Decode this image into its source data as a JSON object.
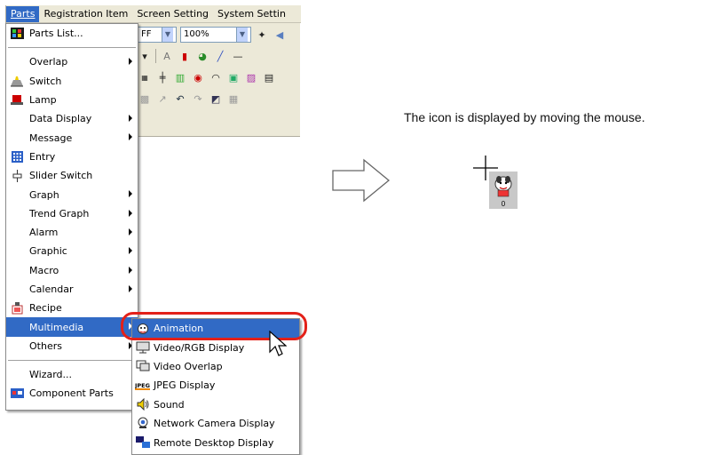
{
  "menubar": {
    "items": [
      {
        "label": "Parts",
        "accel": "P"
      },
      {
        "label": "Registration Item",
        "accel": "R"
      },
      {
        "label": "Screen Setting",
        "accel": "i"
      },
      {
        "label": "System Settin",
        "accel": "y"
      }
    ]
  },
  "toolbar": {
    "field_off": "FF",
    "zoom": "100%"
  },
  "parts_menu": {
    "items": [
      {
        "label": "Parts List...",
        "icon": "parts-list-icon",
        "submenu": false
      },
      {
        "label": "Overlap",
        "icon": "",
        "submenu": true
      },
      {
        "label": "Switch",
        "icon": "switch-icon",
        "submenu": false
      },
      {
        "label": "Lamp",
        "icon": "lamp-icon",
        "submenu": false
      },
      {
        "label": "Data Display",
        "icon": "",
        "submenu": true
      },
      {
        "label": "Message",
        "icon": "",
        "submenu": true
      },
      {
        "label": "Entry",
        "icon": "entry-icon",
        "submenu": false
      },
      {
        "label": "Slider Switch",
        "icon": "slider-switch-icon",
        "submenu": false
      },
      {
        "label": "Graph",
        "icon": "",
        "submenu": true
      },
      {
        "label": "Trend Graph",
        "icon": "",
        "submenu": true
      },
      {
        "label": "Alarm",
        "icon": "",
        "submenu": true
      },
      {
        "label": "Graphic",
        "icon": "",
        "submenu": true
      },
      {
        "label": "Macro",
        "icon": "",
        "submenu": true
      },
      {
        "label": "Calendar",
        "icon": "",
        "submenu": true
      },
      {
        "label": "Recipe",
        "icon": "recipe-icon",
        "submenu": false
      },
      {
        "label": "Multimedia",
        "icon": "",
        "submenu": true,
        "selected": true
      },
      {
        "label": "Others",
        "icon": "",
        "submenu": true
      },
      {
        "label": "Wizard...",
        "icon": "",
        "submenu": false
      },
      {
        "label": "Component Parts",
        "icon": "component-parts-icon",
        "submenu": false
      }
    ]
  },
  "multimedia_menu": {
    "items": [
      {
        "label": "Animation",
        "icon": "animation-icon",
        "selected": true
      },
      {
        "label": "Video/RGB Display",
        "icon": "video-rgb-icon"
      },
      {
        "label": "Video Overlap",
        "icon": "video-overlap-icon"
      },
      {
        "label": "JPEG Display",
        "icon": "jpeg-icon"
      },
      {
        "label": "Sound",
        "icon": "sound-icon"
      },
      {
        "label": "Network Camera Display",
        "icon": "network-camera-icon"
      },
      {
        "label": "Remote Desktop Display",
        "icon": "remote-desktop-icon"
      }
    ]
  },
  "caption": "The icon is displayed by moving the mouse.",
  "anim_icon_label": "0",
  "colors": {
    "selection": "#316ac5",
    "highlight_ring": "#e32119",
    "menubar_bg": "#ece9d8"
  }
}
